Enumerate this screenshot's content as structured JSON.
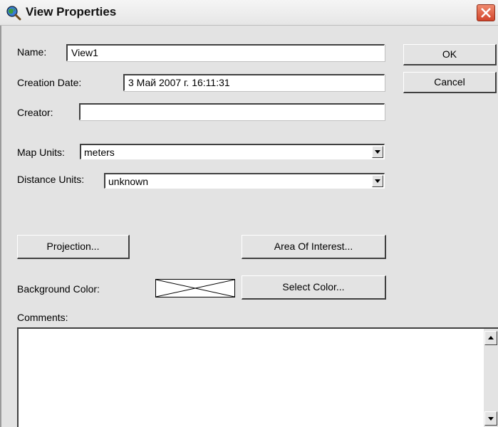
{
  "window": {
    "title": "View Properties",
    "close_icon": "close-icon",
    "app_icon": "globe-magnifier-icon"
  },
  "form": {
    "name_label": "Name:",
    "name_value": "View1",
    "creation_date_label": "Creation Date:",
    "creation_date_value": "3 Май 2007 г. 16:11:31",
    "creator_label": "Creator:",
    "creator_value": "",
    "map_units_label": "Map Units:",
    "map_units_value": "meters",
    "distance_units_label": "Distance Units:",
    "distance_units_value": "unknown",
    "background_color_label": "Background Color:",
    "background_color_value": "none",
    "comments_label": "Comments:",
    "comments_value": ""
  },
  "buttons": {
    "ok": "OK",
    "cancel": "Cancel",
    "projection": "Projection...",
    "area_of_interest": "Area Of Interest...",
    "select_color": "Select Color..."
  },
  "colors": {
    "dialog_bg": "#e3e3e3",
    "close_button": "#d2452b"
  }
}
